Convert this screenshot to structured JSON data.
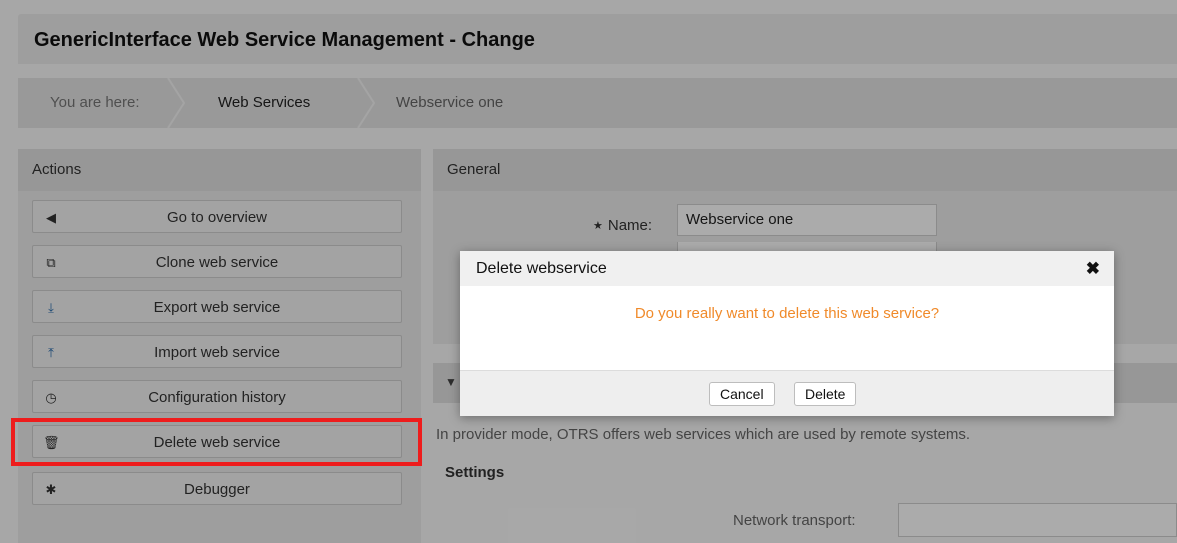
{
  "page": {
    "title": "GenericInterface Web Service Management - Change",
    "breadcrumb": [
      "You are here:",
      "Web Services",
      "Webservice one"
    ]
  },
  "actions": {
    "heading": "Actions",
    "items": [
      {
        "label": "Go to overview",
        "icon": "chevron-left-icon"
      },
      {
        "label": "Clone web service",
        "icon": "copy-icon"
      },
      {
        "label": "Export web service",
        "icon": "download-icon"
      },
      {
        "label": "Import web service",
        "icon": "upload-icon"
      },
      {
        "label": "Configuration history",
        "icon": "clock-icon"
      },
      {
        "label": "Delete web service",
        "icon": "trash-icon"
      },
      {
        "label": "Debugger",
        "icon": "bug-icon"
      }
    ],
    "highlight_color": "#ee1c1c"
  },
  "general": {
    "heading": "General",
    "name_label": "Name:",
    "name_value": "Webservice one"
  },
  "provider": {
    "description": "In provider mode, OTRS offers web services which are used by remote systems.",
    "settings_heading": "Settings",
    "network_transport_label": "Network transport:"
  },
  "dialog": {
    "title": "Delete webservice",
    "message": "Do you really want to delete this web service?",
    "cancel_label": "Cancel",
    "delete_label": "Delete",
    "message_color": "#f08a2a"
  }
}
